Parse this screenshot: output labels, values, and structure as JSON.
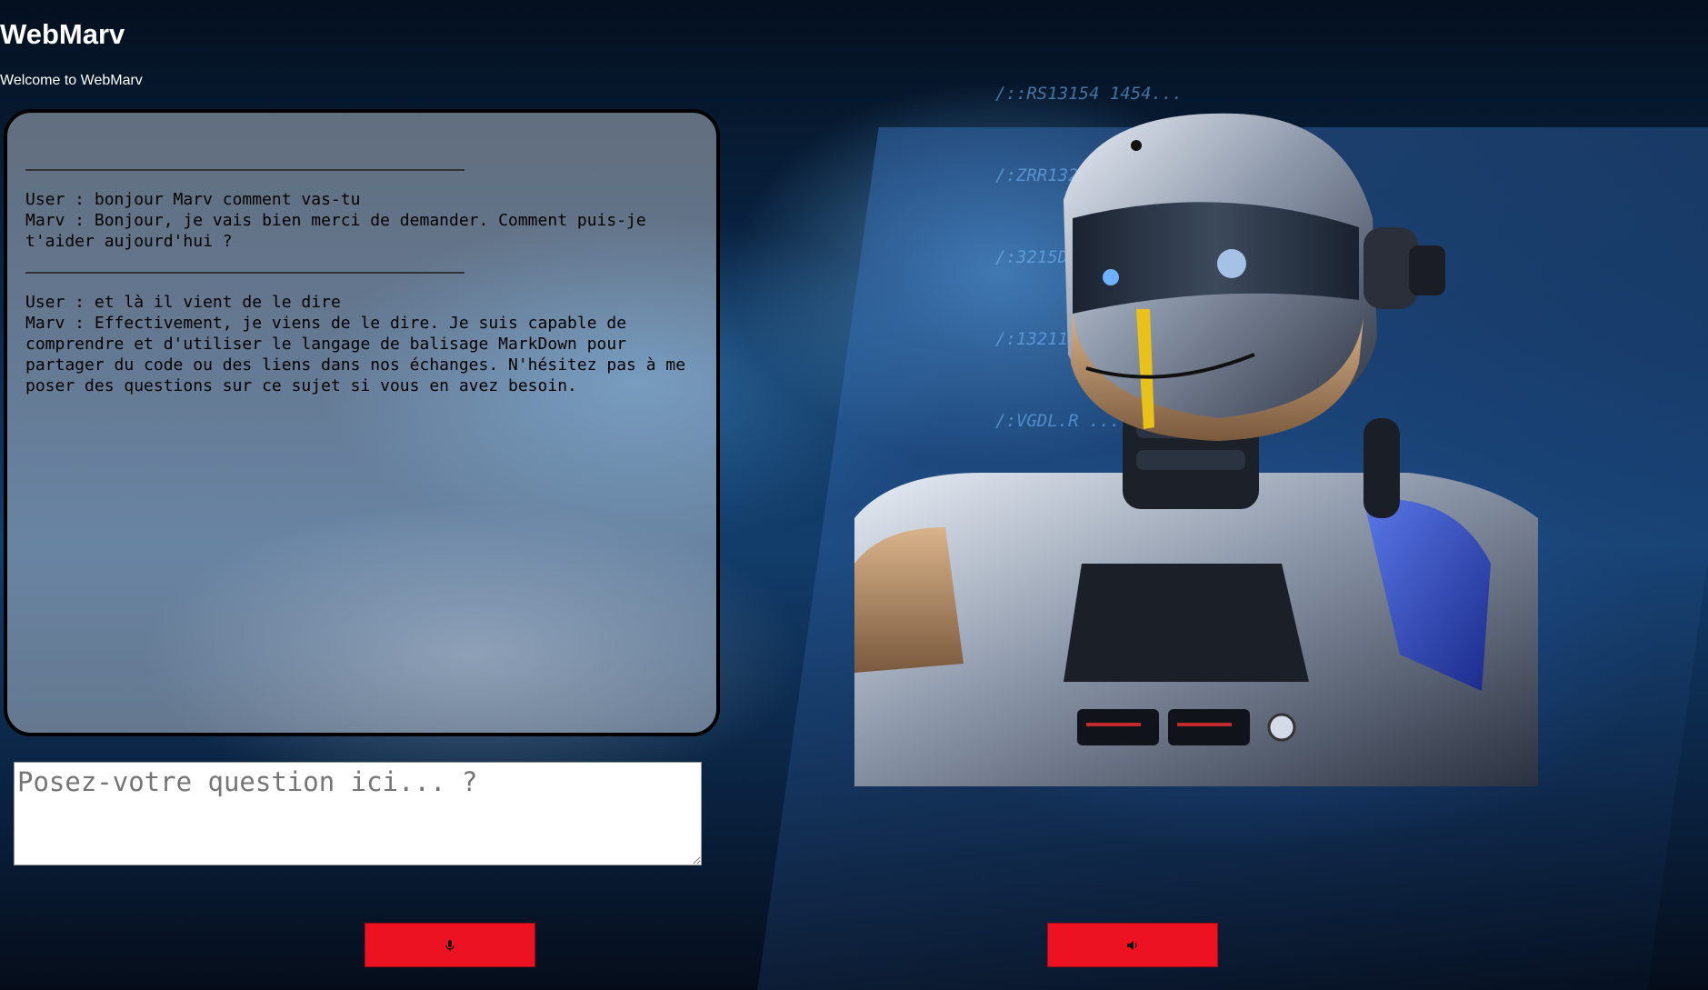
{
  "header": {
    "title": "WebMarv",
    "subtitle": "Welcome to WebMarv"
  },
  "chat": {
    "messages": [
      {
        "user": "User : bonjour Marv comment vas-tu",
        "assistant": "Marv : Bonjour, je vais bien merci de demander. Comment puis-je t'aider aujourd'hui ?"
      },
      {
        "user": "User : et là il vient de le dire",
        "assistant": "Marv : Effectivement, je viens de le dire. Je suis capable de comprendre et d'utiliser le langage de balisage MarkDown pour partager du code ou des liens dans nos échanges. N'hésitez pas à me poser des questions sur ce sujet si vous en avez besoin."
      }
    ]
  },
  "input": {
    "placeholder": "Posez-votre question ici... ?",
    "value": ""
  },
  "buttons": {
    "mic_icon": "microphone-icon",
    "speaker_icon": "speaker-icon"
  },
  "colors": {
    "button_bg": "#ed1222",
    "panel_border": "#000000"
  },
  "background_text": [
    "/::RS13154 1454...",
    "/:ZRR13251 ...",
    "/:3215D1123 ...",
    "/:13211 ACDCEW ...",
    "/:VGDL.R ..."
  ]
}
